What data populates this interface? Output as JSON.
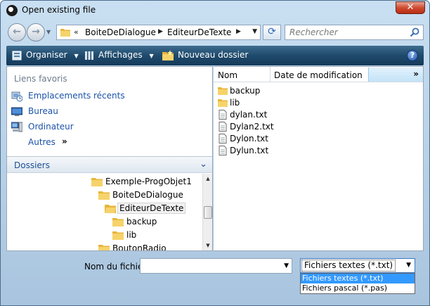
{
  "window": {
    "title": "Open existing file"
  },
  "address": {
    "overflow": "«",
    "crumbs": [
      "BoiteDeDialogue",
      "EditeurDeTexte"
    ]
  },
  "search": {
    "placeholder": "Rechercher"
  },
  "toolbar": {
    "organize": "Organiser",
    "views": "Affichages",
    "new_folder": "Nouveau dossier"
  },
  "favorites": {
    "header": "Liens favoris",
    "items": [
      "Emplacements récents",
      "Bureau",
      "Ordinateur"
    ],
    "more": "Autres",
    "more_chevron": "»"
  },
  "folders": {
    "header": "Dossiers",
    "tree": [
      "Exemple-ProgObjet1",
      "BoiteDeDialogue",
      "EditeurDeTexte",
      "backup",
      "lib",
      "BoutonRadio"
    ],
    "selected": "EditeurDeTexte"
  },
  "files": {
    "columns": {
      "name": "Nom",
      "date": "Date de modification",
      "more": "»"
    },
    "items": [
      {
        "name": "backup",
        "type": "folder"
      },
      {
        "name": "lib",
        "type": "folder"
      },
      {
        "name": "dylan.txt",
        "type": "file"
      },
      {
        "name": "Dylan2.txt",
        "type": "file"
      },
      {
        "name": "Dylon.txt",
        "type": "file"
      },
      {
        "name": "Dylun.txt",
        "type": "file"
      }
    ]
  },
  "bottom": {
    "filename_label": "Nom du fichier :",
    "filename_value": "",
    "filter_selected": "Fichiers textes (*.txt)",
    "filter_options": [
      "Fichiers textes (*.txt)",
      "Fichiers pascal (*.pas)"
    ]
  },
  "colors": {
    "toolbar": "#1f4a6c",
    "link": "#1a52a8",
    "selection": "#3399ff",
    "folder": "#f2c94c"
  }
}
